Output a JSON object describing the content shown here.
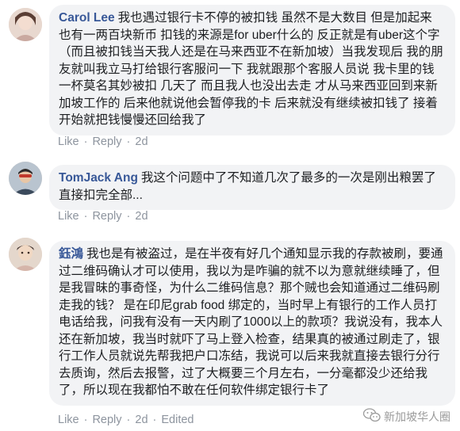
{
  "comments": [
    {
      "author": "Carol Lee",
      "text": "我也遇过银行卡不停的被扣钱 虽然不是大数目 但是加起来 也有一两百块新币 扣钱的来源是for uber什么的 反正就是有uber这个字 （而且被扣钱当天我人还是在马来西亚不在新加坡）当我发现后 我的朋友就叫我立马打给银行客服问一下 我就跟那个客服人员说 我卡里的钱一杯莫名其妙被扣 几天了 而且我人也没出去走 才从马来西亚回到来新加坡工作的 后来他就说他会暂停我的卡 后来就没有继续被扣钱了 接着开始就把钱慢慢还回给我了",
      "like": "Like",
      "reply": "Reply",
      "time": "2d"
    },
    {
      "author": "TomJack Ang",
      "text": "我这个问题中了不知道几次了最多的一次是刚出粮罢了直接扣完全部...",
      "like": "Like",
      "reply": "Reply",
      "time": "2d"
    },
    {
      "author": "鈺鴻",
      "text": "我也是有被盗过，是在半夜有好几个通知显示我的存款被刷，要通过二维码确认才可以使用，我以为是咋骗的就不以为意就继续睡了，但是我冒昧的事奇怪，为什么二维码信息？那个贼也会知道通过二维码刷走我的钱？ 是在印尼grab food 绑定的，当时早上有银行的工作人员打电话给我，问我有没有一天内刷了1000以上的款项？我说没有，我本人还在新加坡，我当时就吓了马上登入检查，结果真的被通过刷走了，银行工作人员就说先帮我把户口冻结，我说可以后来我就直接去银行分行去质询，然后去报警，过了大概要三个月左右，一分毫都没少还给我了，所以现在我都怕不敢在任何软件绑定银行卡了",
      "like": "Like",
      "reply": "Reply",
      "time": "2d",
      "edited": "Edited"
    }
  ],
  "watermark": {
    "text": "新加坡华人圈",
    "icon": "wechat-icon"
  }
}
